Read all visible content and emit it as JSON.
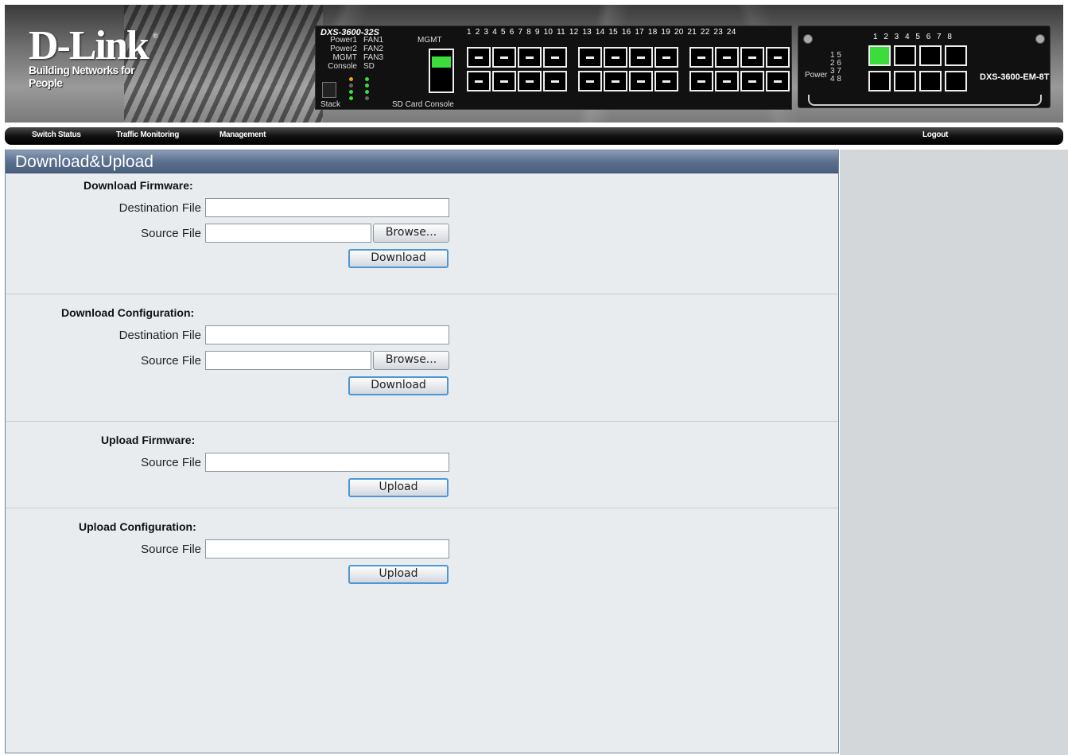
{
  "banner": {
    "logo_brand": "D-Link",
    "logo_reg": "®",
    "logo_tagline": "Building Networks for People",
    "switch_model": "DXS-3600-32S",
    "led_labels_left": [
      "Power1",
      "Power2",
      "MGMT",
      "Console"
    ],
    "led_labels_right": [
      "FAN1",
      "FAN2",
      "FAN3",
      "SD"
    ],
    "mgmt_label": "MGMT",
    "stack_label": "Stack",
    "sd_console_label": "SD Card Console",
    "port_numbers": "1 2 3 4 5 6 7 8 9 10 11 12 13 14 15 16 17 18 19 20 21 22 23 24",
    "module_port_numbers": "1 2 3 4 5 6 7 8",
    "module_power_label": "Power",
    "module_led_rows": [
      "1 5",
      "2 6",
      "3 7",
      "4 8"
    ],
    "module_name": "DXS-3600-EM-8T"
  },
  "nav": {
    "switch_status": "Switch Status",
    "traffic_monitoring": "Traffic Monitoring",
    "management": "Management",
    "logout": "Logout"
  },
  "page": {
    "title": "Download&Upload"
  },
  "sections": {
    "download_firmware": {
      "title": "Download Firmware:",
      "destination_label": "Destination File",
      "destination_value": "",
      "source_label": "Source File",
      "source_value": "",
      "browse_label": "Browse...",
      "action_label": "Download"
    },
    "download_configuration": {
      "title": "Download Configuration:",
      "destination_label": "Destination File",
      "destination_value": "",
      "source_label": "Source File",
      "source_value": "",
      "browse_label": "Browse...",
      "action_label": "Download"
    },
    "upload_firmware": {
      "title": "Upload Firmware:",
      "source_label": "Source File",
      "source_value": "",
      "action_label": "Upload"
    },
    "upload_configuration": {
      "title": "Upload Configuration:",
      "source_label": "Source File",
      "source_value": "",
      "action_label": "Upload"
    }
  },
  "colors": {
    "title_bar": "#5c7190",
    "content_bg": "#e8ecee",
    "nav_bg": "#111111",
    "button_focus": "#4d97d6"
  }
}
